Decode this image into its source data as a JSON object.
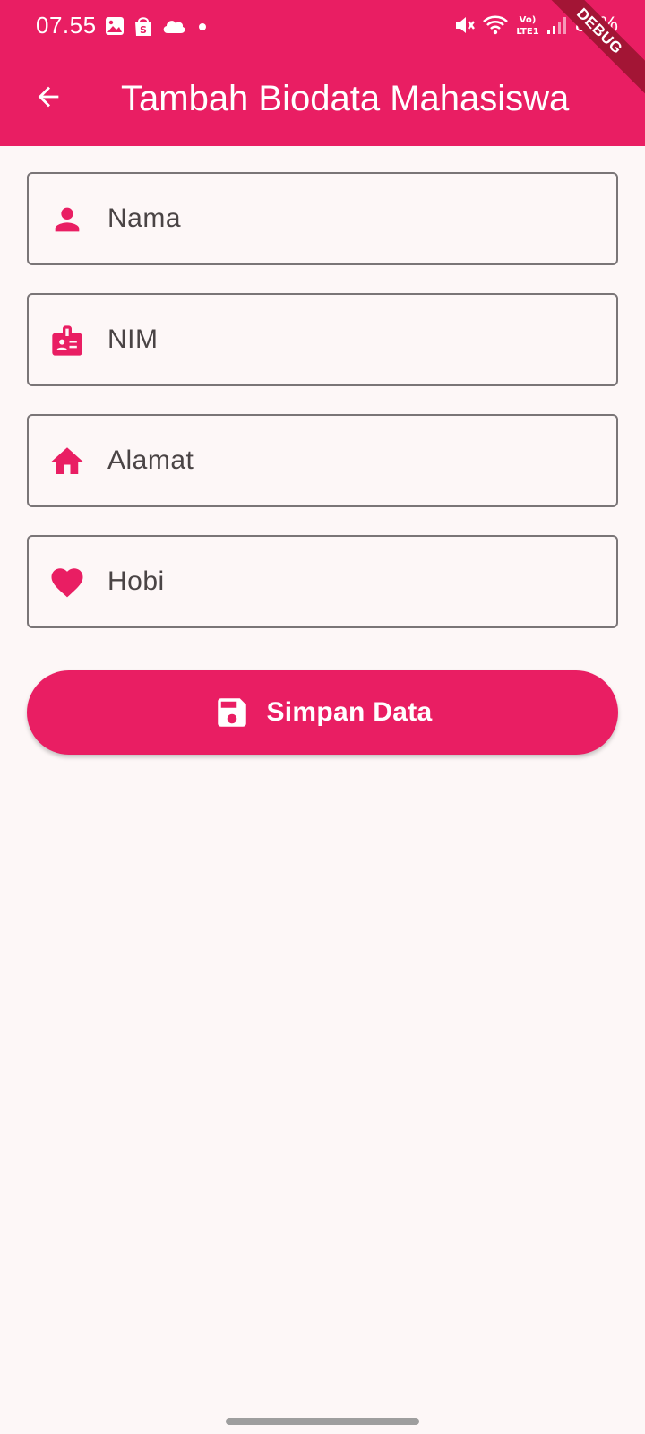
{
  "status_bar": {
    "time": "07.55",
    "battery": "85%",
    "left_icons": [
      "gallery-icon",
      "shopee-icon",
      "cloud-icon",
      "dot-icon"
    ],
    "right_icons": [
      "mute-icon",
      "wifi-icon",
      "volte-icon",
      "signal-icon"
    ]
  },
  "app_bar": {
    "title": "Tambah Biodata Mahasiswa",
    "back_icon": "arrow-back-icon"
  },
  "debug_banner": "DEBUG",
  "form": {
    "fields": [
      {
        "placeholder": "Nama",
        "value": "",
        "icon": "person-icon"
      },
      {
        "placeholder": "NIM",
        "value": "",
        "icon": "badge-icon"
      },
      {
        "placeholder": "Alamat",
        "value": "",
        "icon": "home-icon"
      },
      {
        "placeholder": "Hobi",
        "value": "",
        "icon": "heart-icon"
      }
    ]
  },
  "save_button": {
    "label": "Simpan Data",
    "icon": "save-icon"
  },
  "colors": {
    "primary": "#E91E63",
    "background": "#FDF7F7",
    "border": "#7A7577",
    "text": "#4A4445",
    "debug_ribbon": "#A31535"
  }
}
